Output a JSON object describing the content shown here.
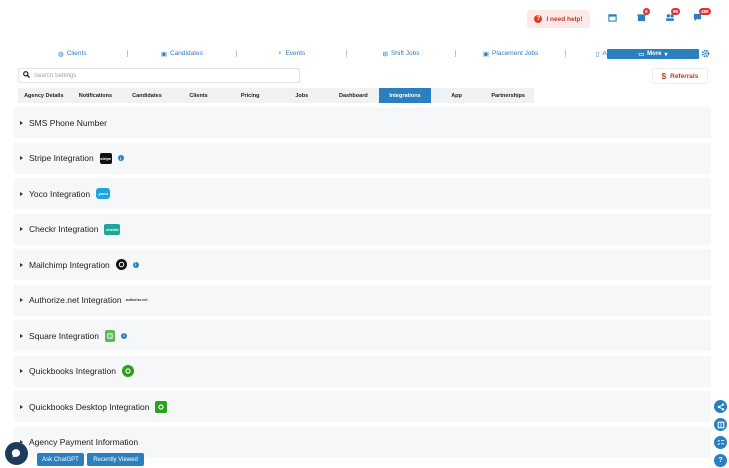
{
  "header": {
    "help_label": "I need help!",
    "icons": [
      {
        "name": "calendar-icon",
        "badge": ""
      },
      {
        "name": "store-icon",
        "badge": "9"
      },
      {
        "name": "users-icon",
        "badge": "96"
      },
      {
        "name": "chat-icon",
        "badge": "489"
      }
    ]
  },
  "nav": {
    "items": [
      {
        "label": "Clients",
        "icon": "globe-icon"
      },
      {
        "label": "Candidates",
        "icon": "briefcase-icon"
      },
      {
        "label": "Events",
        "icon": "trophy-icon"
      },
      {
        "label": "Shift Jobs",
        "icon": "shift-icon"
      },
      {
        "label": "Placement Jobs",
        "icon": "briefcase-icon"
      },
      {
        "label": "App",
        "icon": "mobile-icon"
      }
    ],
    "more_label": "More"
  },
  "search": {
    "placeholder": "Search Settings"
  },
  "referrals_label": "Referrals",
  "tabs": [
    {
      "label": "Agency Details",
      "active": false
    },
    {
      "label": "Notifications",
      "active": false
    },
    {
      "label": "Candidates",
      "active": false
    },
    {
      "label": "Clients",
      "active": false
    },
    {
      "label": "Pricing",
      "active": false
    },
    {
      "label": "Jobs",
      "active": false
    },
    {
      "label": "Dashboard",
      "active": false
    },
    {
      "label": "Integrations",
      "active": true
    },
    {
      "label": "App",
      "active": false
    },
    {
      "label": "Partnerships",
      "active": false
    }
  ],
  "rows": [
    {
      "label": "SMS Phone Number"
    },
    {
      "label": "Stripe Integration",
      "logo_text": "stripe"
    },
    {
      "label": "Yoco Integration",
      "logo_text": "yoco"
    },
    {
      "label": "Checkr Integration",
      "logo_text": "checkr"
    },
    {
      "label": "Mailchimp Integration"
    },
    {
      "label": "Authorize.net Integration",
      "logo_text": "authorize.net"
    },
    {
      "label": "Square Integration"
    },
    {
      "label": "Quickbooks Integration"
    },
    {
      "label": "Quickbooks Desktop Integration"
    },
    {
      "label": "Agency Payment Information"
    }
  ],
  "bottom": {
    "ask_label": "Ask ChatGPT",
    "recent_label": "Recently Viewed"
  },
  "colors": {
    "accent": "#2a7fbf",
    "danger": "#d9402b"
  }
}
